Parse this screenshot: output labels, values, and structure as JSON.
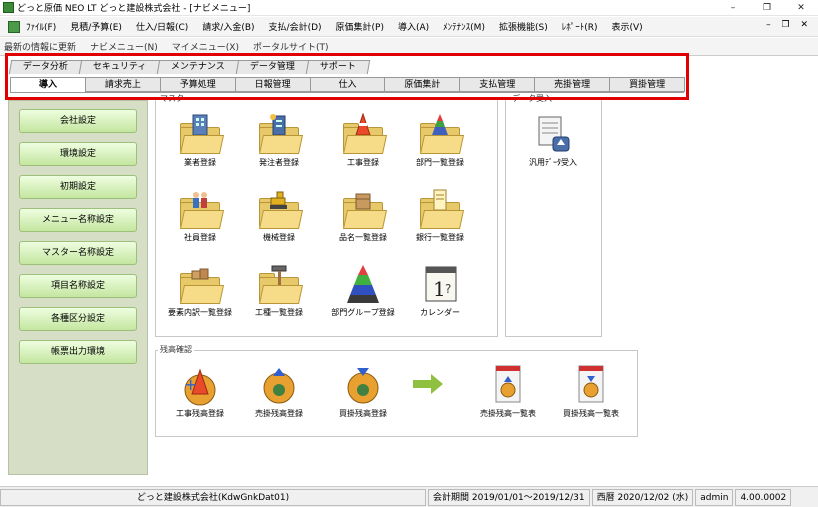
{
  "window": {
    "title": "どっと原価 NEO LT どっと建設株式会社 - [ナビメニュー]",
    "controls": [
      "–",
      "❐",
      "✕"
    ]
  },
  "menubar": {
    "items": [
      "ﾌｧｲﾙ(F)",
      "見積/予算(E)",
      "仕入/日報(C)",
      "請求/入金(B)",
      "支払/会計(D)",
      "原価集計(P)",
      "導入(A)",
      "ﾒﾝﾃﾅﾝｽ(M)",
      "拡張機能(S)",
      "ﾚﾎﾟｰﾄ(R)",
      "表示(V)"
    ],
    "mdi": "– ❐ ✕"
  },
  "toolbar2": {
    "items": [
      "最新の情報に更新",
      "ナビメニュー(N)",
      "マイメニュー(X)",
      "ポータルサイト(T)"
    ]
  },
  "tabs_upper": [
    "データ分析",
    "セキュリティ",
    "メンテナンス",
    "データ管理",
    "サポート"
  ],
  "tabs_lower": {
    "active": "導入",
    "items": [
      "導入",
      "請求売上",
      "予算処理",
      "日報管理",
      "仕入",
      "原価集計",
      "支払管理",
      "売掛管理",
      "買掛管理"
    ]
  },
  "sidebar": {
    "buttons": [
      "会社設定",
      "環境設定",
      "初期設定",
      "メニュー名称設定",
      "マスター名称設定",
      "項目名称設定",
      "各種区分設定",
      "帳票出力環境"
    ]
  },
  "master_group": {
    "label": "マスター",
    "items": [
      "業者登録",
      "発注者登録",
      "工事登録",
      "部門一覧登録",
      "社員登録",
      "機械登録",
      "品名一覧登録",
      "銀行一覧登録",
      "要素内訳一覧登録",
      "工種一覧登録",
      "部門グループ登録",
      "カレンダー"
    ]
  },
  "data_import_group": {
    "label": "データ受入",
    "items": [
      "汎用ﾃﾞｰﾀ受入"
    ]
  },
  "balance_group": {
    "label": "残高確認",
    "items": [
      "工事残高登録",
      "売掛残高登録",
      "買掛残高登録",
      "売掛残高一覧表",
      "買掛残高一覧表"
    ]
  },
  "statusbar": {
    "company": "どっと建設株式会社(KdwGnkDat01)",
    "period": "会計期間 2019/01/01～2019/12/31",
    "date": "西暦 2020/12/02 (水)",
    "user": "admin",
    "version": "4.00.0002"
  },
  "colors": {
    "highlight": "#e00000",
    "sidebar_bg": "#d6dfc6",
    "button_green": "#c4e6a0"
  }
}
